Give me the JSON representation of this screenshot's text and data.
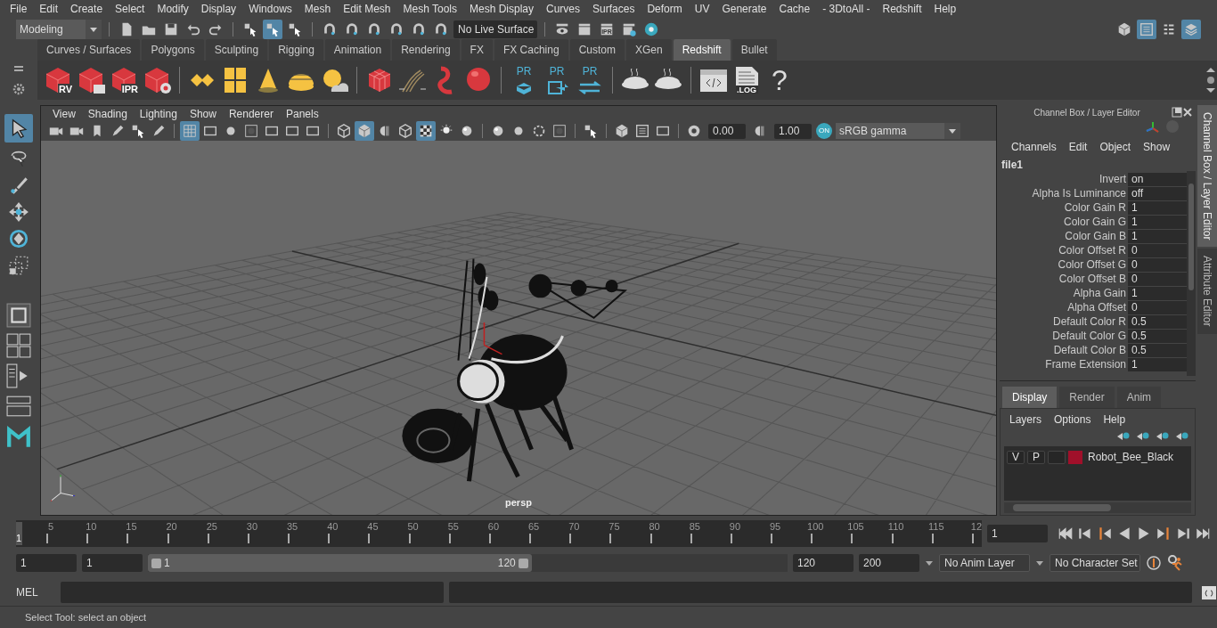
{
  "menu_bar": [
    "File",
    "Edit",
    "Create",
    "Select",
    "Modify",
    "Display",
    "Windows",
    "Mesh",
    "Edit Mesh",
    "Mesh Tools",
    "Mesh Display",
    "Curves",
    "Surfaces",
    "Deform",
    "UV",
    "Generate",
    "Cache",
    "- 3DtoAll -",
    "Redshift",
    "Help"
  ],
  "status_line": {
    "mode": "Modeling",
    "live_surface": "No Live Surface",
    "ipr_label": "IPR"
  },
  "shelf": {
    "tabs": [
      {
        "label": "Curves / Surfaces",
        "selected": false
      },
      {
        "label": "Polygons",
        "selected": false
      },
      {
        "label": "Sculpting",
        "selected": false
      },
      {
        "label": "Rigging",
        "selected": false
      },
      {
        "label": "Animation",
        "selected": false
      },
      {
        "label": "Rendering",
        "selected": false
      },
      {
        "label": "FX",
        "selected": false
      },
      {
        "label": "FX Caching",
        "selected": false
      },
      {
        "label": "Custom",
        "selected": false
      },
      {
        "label": "XGen",
        "selected": false
      },
      {
        "label": "Redshift",
        "selected": true
      },
      {
        "label": "Bullet",
        "selected": false
      }
    ],
    "render_view_label": "RV",
    "ipr_label": "IPR",
    "proxy_labels": [
      "PR",
      "PR",
      "PR"
    ],
    "log_label": ".LOG",
    "help_label": "?"
  },
  "viewport": {
    "menus": [
      "View",
      "Shading",
      "Lighting",
      "Show",
      "Renderer",
      "Panels"
    ],
    "exposure": "0.00",
    "gamma": "1.00",
    "color_management_label": "ON",
    "color_space": "sRGB gamma",
    "camera": "persp"
  },
  "channel_box": {
    "title": "Channel Box / Layer Editor",
    "menus": [
      "Channels",
      "Edit",
      "Object",
      "Show"
    ],
    "node": "file1",
    "attributes": [
      {
        "name": "Invert",
        "value": "on"
      },
      {
        "name": "Alpha Is Luminance",
        "value": "off"
      },
      {
        "name": "Color Gain R",
        "value": "1"
      },
      {
        "name": "Color Gain G",
        "value": "1"
      },
      {
        "name": "Color Gain B",
        "value": "1"
      },
      {
        "name": "Color Offset R",
        "value": "0"
      },
      {
        "name": "Color Offset G",
        "value": "0"
      },
      {
        "name": "Color Offset B",
        "value": "0"
      },
      {
        "name": "Alpha Gain",
        "value": "1"
      },
      {
        "name": "Alpha Offset",
        "value": "0"
      },
      {
        "name": "Default Color R",
        "value": "0.5"
      },
      {
        "name": "Default Color G",
        "value": "0.5"
      },
      {
        "name": "Default Color B",
        "value": "0.5"
      },
      {
        "name": "Frame Extension",
        "value": "1"
      }
    ]
  },
  "layer_editor": {
    "tabs": [
      {
        "label": "Display",
        "selected": true
      },
      {
        "label": "Render",
        "selected": false
      },
      {
        "label": "Anim",
        "selected": false
      }
    ],
    "menus": [
      "Layers",
      "Options",
      "Help"
    ],
    "layers": [
      {
        "visible": "V",
        "playback": "P",
        "color": "#a0102a",
        "name": "Robot_Bee_Black"
      }
    ]
  },
  "side_tabs": [
    {
      "label": "Channel Box / Layer Editor",
      "selected": true
    },
    {
      "label": "Attribute Editor",
      "selected": false
    }
  ],
  "time_slider": {
    "ticks": [
      "5",
      "10",
      "15",
      "20",
      "25",
      "30",
      "35",
      "40",
      "45",
      "50",
      "55",
      "60",
      "65",
      "70",
      "75",
      "80",
      "85",
      "90",
      "95",
      "100",
      "105",
      "110",
      "115",
      "12"
    ],
    "current_marker": "1",
    "level": 0,
    "current_frame": "1"
  },
  "range_slider": {
    "start": "1",
    "playback_start": "1",
    "slider_start": "1",
    "slider_end": "120",
    "level": 0.6,
    "playback_end": "120",
    "end": "200",
    "anim_layer": "No Anim Layer",
    "character_set": "No Character Set"
  },
  "command_line": {
    "label": "MEL"
  },
  "help_line": "Select Tool: select an object"
}
